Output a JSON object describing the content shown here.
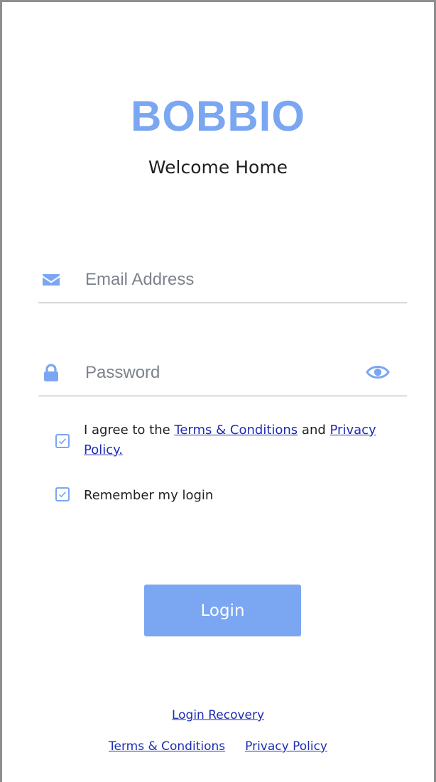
{
  "app": {
    "title": "BOBBIO",
    "tagline": "Welcome Home"
  },
  "form": {
    "email": {
      "placeholder": "Email Address",
      "value": "",
      "icon": "envelope-icon"
    },
    "password": {
      "placeholder": "Password",
      "value": "",
      "icon": "lock-icon",
      "toggle_icon": "eye-icon"
    },
    "agree_terms": {
      "checked": true,
      "text_before": "I agree to the ",
      "terms_link": "Terms & Conditions",
      "text_middle": " and ",
      "privacy_link": "Privacy Policy."
    },
    "remember_me": {
      "checked": true,
      "label": "Remember my login"
    },
    "login_button": "Login"
  },
  "footer": {
    "recovery_link": "Login Recovery",
    "terms_link": "Terms & Conditions",
    "privacy_link": "Privacy Policy"
  },
  "colors": {
    "accent": "#7aa6f2",
    "link": "#1e2db3",
    "divider": "#9aa0a6"
  }
}
